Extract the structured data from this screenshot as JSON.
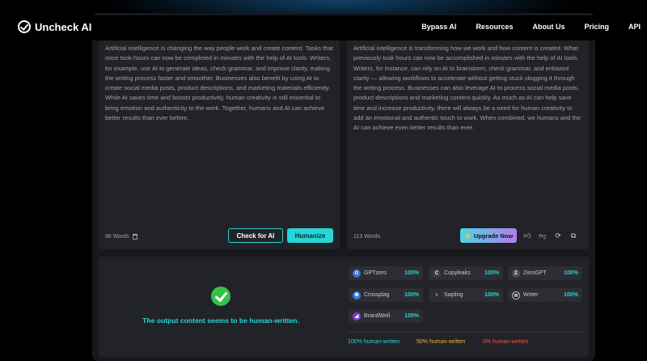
{
  "nav": {
    "brand": "Uncheck AI",
    "links": [
      "Bypass AI",
      "Resources",
      "About Us",
      "Pricing",
      "API"
    ]
  },
  "input_panel": {
    "text": "Artificial intelligence is changing the way people work and create content. Tasks that once took hours can now be completed in minutes with the help of AI tools. Writers, for example, use AI to generate ideas, check grammar, and improve clarity, making the writing process faster and smoother. Businesses also benefit by using AI to create social media posts, product descriptions, and marketing materials efficiently. While AI saves time and boosts productivity, human creativity is still essential to bring emotion and authenticity to the work. Together, humans and AI can achieve better results than ever before.",
    "word_count": "96 Words",
    "check_label": "Check for AI",
    "humanize_label": "Humanize"
  },
  "output_panel": {
    "text": "Artificial intelligence is transforming how we work and how content is created. What previously took hours can now be accomplished in minutes with the help of AI tools. Writers, for instance, can rely on AI to brainstorm, check grammar, and enhance clarity — allowing workflows to accelerate without getting stuck slogging it through the writing process. Businesses can also leverage AI to process social media posts, product descriptions and marketing content quickly. As much as AI can help save time and increase productivity, there will always be a need for human creativity to add an emotional and authentic touch to work. When combined, we humans and the AI can achieve even better results than ever.",
    "word_count": "113 Words",
    "upgrade_label": "Upgrade Now"
  },
  "result": {
    "message": "The output content seems to be human-written."
  },
  "detectors": [
    {
      "name": "GPTzero",
      "pct": "100%",
      "icon": "gptzero-icon",
      "color": "#3a6fd8"
    },
    {
      "name": "Copyleaks",
      "pct": "100%",
      "icon": "copyleaks-icon",
      "color": "#3b3f48"
    },
    {
      "name": "ZeroGPT",
      "pct": "100%",
      "icon": "zerogpt-icon",
      "color": "#4a4d55"
    },
    {
      "name": "Crossplag",
      "pct": "100%",
      "icon": "crossplag-icon",
      "color": "#2f7fe0"
    },
    {
      "name": "Sapling",
      "pct": "100%",
      "icon": "sapling-icon",
      "color": "#2d2e34"
    },
    {
      "name": "Writer",
      "pct": "100%",
      "icon": "writer-icon",
      "color": "#111"
    },
    {
      "name": "BrandWell",
      "pct": "100%",
      "icon": "brandwell-icon",
      "color": "#7a3fd8"
    }
  ],
  "legend": {
    "green": "100% human-written",
    "yellow": "50% human-written",
    "red": "0% human-written"
  },
  "colors": {
    "accent": "#27d6d6",
    "success": "#34c24a",
    "warning": "#f2b52b",
    "danger": "#ff4f4f"
  }
}
